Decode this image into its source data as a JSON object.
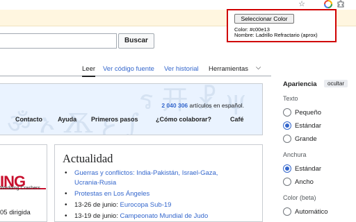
{
  "toolbar": {
    "icons": [
      "star-icon",
      "color-picker-extension-icon",
      "puzzle-extensions-icon",
      "folder-icon"
    ]
  },
  "search": {
    "button_label": "Buscar",
    "placeholder": ""
  },
  "tabs": [
    {
      "label": "Leer",
      "selected": true
    },
    {
      "label": "Ver código fuente"
    },
    {
      "label": "Ver historial"
    },
    {
      "label": "Herramientas"
    }
  ],
  "portal": {
    "article_count": "2 040 306",
    "article_suffix": "artículos en español.",
    "nav": [
      "Contacto",
      "Ayuda",
      "Primeros pasos",
      "¿Cómo colaborar?",
      "Café"
    ]
  },
  "left_box": {
    "banner_text": "ING",
    "banner_caption": "Wedding Crashers",
    "body_text": "05 dirigida"
  },
  "news": {
    "heading": "Actualidad",
    "items": [
      {
        "line1": "Guerras y conflictos: India-Pakistán, Israel-Gaza,",
        "line2": "Ucrania-Rusia"
      },
      {
        "line1": "Protestas en Los Ángeles"
      },
      {
        "prefix": "13-26 de junio: ",
        "link": "Eurocopa Sub-19"
      },
      {
        "prefix": "13-19 de junio: ",
        "link": "Campeonato Mundial de Judo"
      }
    ]
  },
  "appearance": {
    "title": "Apariencia",
    "hide_label": "ocultar",
    "text_section": "Texto",
    "text_options": [
      {
        "label": "Pequeño",
        "selected": false
      },
      {
        "label": "Estándar",
        "selected": true
      },
      {
        "label": "Grande",
        "selected": false
      }
    ],
    "width_section": "Anchura",
    "width_options": [
      {
        "label": "Estándar",
        "selected": true
      },
      {
        "label": "Ancho",
        "selected": false
      }
    ],
    "color_section": "Color (beta)",
    "color_options": [
      {
        "label": "Automático",
        "selected": false
      }
    ]
  },
  "popup": {
    "button_label": "Seleccionar Color",
    "color_line": "Color: #c00e13",
    "name_line": "Nombre: Ladrillo Refractario (aprox)"
  },
  "colors": {
    "picked_color": "#c00e13",
    "link": "#3366cc",
    "popup_border": "#d00000"
  }
}
